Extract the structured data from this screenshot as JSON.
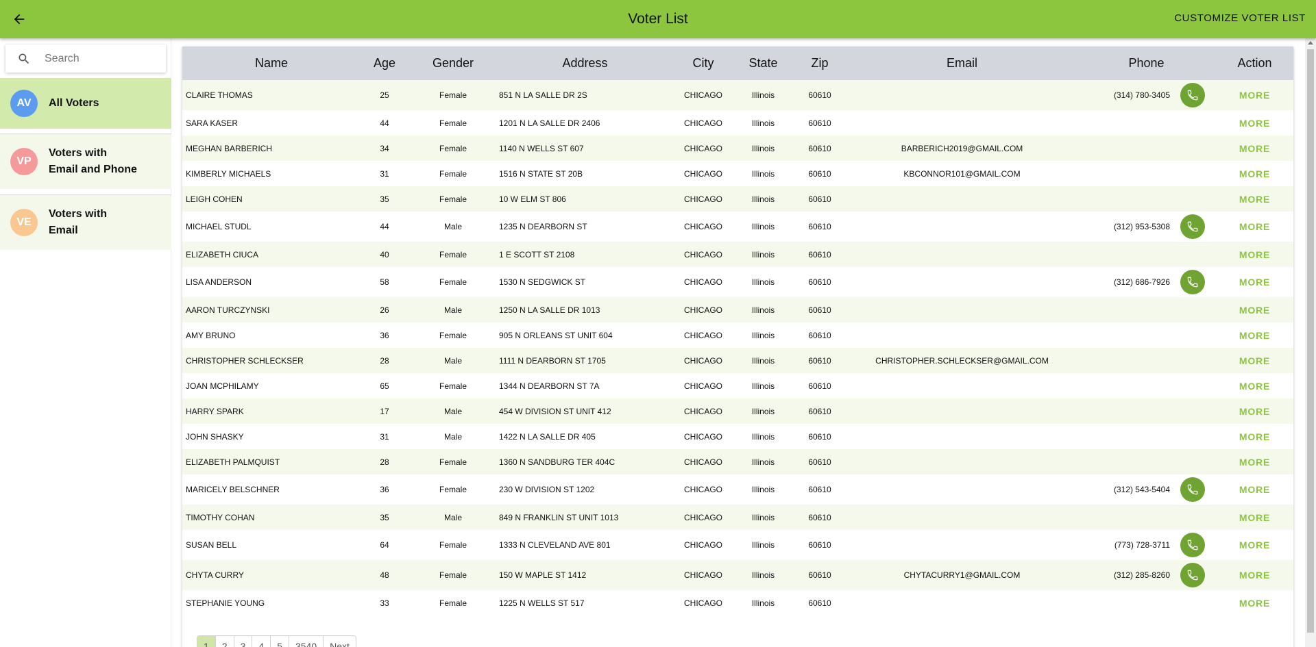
{
  "header": {
    "title": "Voter List",
    "customize_label": "CUSTOMIZE VOTER LIST",
    "bar_color": "#8cc63f"
  },
  "sidebar": {
    "search_placeholder": "Search",
    "items": [
      {
        "initials": "AV",
        "label_line1": "All Voters",
        "label_line2": "",
        "avatar_color": "#5b9cf0",
        "active": true
      },
      {
        "initials": "VP",
        "label_line1": "Voters with",
        "label_line2": "Email and Phone",
        "avatar_color": "#f59a9a",
        "active": false
      },
      {
        "initials": "VE",
        "label_line1": "Voters with",
        "label_line2": "Email",
        "avatar_color": "#fbc790",
        "active": false
      }
    ]
  },
  "table": {
    "columns": [
      "Name",
      "Age",
      "Gender",
      "Address",
      "City",
      "State",
      "Zip",
      "Email",
      "Phone",
      "Action"
    ],
    "action_label": "MORE",
    "rows": [
      {
        "name": "CLAIRE THOMAS",
        "age": "25",
        "gender": "Female",
        "address": "851 N LA SALLE DR 2S",
        "city": "CHICAGO",
        "state": "Illinois",
        "zip": "60610",
        "email": "",
        "phone": "(314) 780-3405"
      },
      {
        "name": "SARA KASER",
        "age": "44",
        "gender": "Female",
        "address": "1201 N LA SALLE DR 2406",
        "city": "CHICAGO",
        "state": "Illinois",
        "zip": "60610",
        "email": "",
        "phone": ""
      },
      {
        "name": "MEGHAN BARBERICH",
        "age": "34",
        "gender": "Female",
        "address": "1140 N WELLS ST 607",
        "city": "CHICAGO",
        "state": "Illinois",
        "zip": "60610",
        "email": "BARBERICH2019@GMAIL.COM",
        "phone": ""
      },
      {
        "name": "KIMBERLY MICHAELS",
        "age": "31",
        "gender": "Female",
        "address": "1516 N STATE ST 20B",
        "city": "CHICAGO",
        "state": "Illinois",
        "zip": "60610",
        "email": "KBCONNOR101@GMAIL.COM",
        "phone": ""
      },
      {
        "name": "LEIGH COHEN",
        "age": "35",
        "gender": "Female",
        "address": "10 W ELM ST 806",
        "city": "CHICAGO",
        "state": "Illinois",
        "zip": "60610",
        "email": "",
        "phone": ""
      },
      {
        "name": "MICHAEL STUDL",
        "age": "44",
        "gender": "Male",
        "address": "1235 N DEARBORN ST",
        "city": "CHICAGO",
        "state": "Illinois",
        "zip": "60610",
        "email": "",
        "phone": "(312) 953-5308"
      },
      {
        "name": "ELIZABETH CIUCA",
        "age": "40",
        "gender": "Female",
        "address": "1 E SCOTT ST 2108",
        "city": "CHICAGO",
        "state": "Illinois",
        "zip": "60610",
        "email": "",
        "phone": ""
      },
      {
        "name": "LISA ANDERSON",
        "age": "58",
        "gender": "Female",
        "address": "1530 N SEDGWICK ST",
        "city": "CHICAGO",
        "state": "Illinois",
        "zip": "60610",
        "email": "",
        "phone": "(312) 686-7926"
      },
      {
        "name": "AARON TURCZYNSKI",
        "age": "26",
        "gender": "Male",
        "address": "1250 N LA SALLE DR 1013",
        "city": "CHICAGO",
        "state": "Illinois",
        "zip": "60610",
        "email": "",
        "phone": ""
      },
      {
        "name": "AMY BRUNO",
        "age": "36",
        "gender": "Female",
        "address": "905 N ORLEANS ST UNIT 604",
        "city": "CHICAGO",
        "state": "Illinois",
        "zip": "60610",
        "email": "",
        "phone": ""
      },
      {
        "name": "CHRISTOPHER SCHLECKSER",
        "age": "28",
        "gender": "Male",
        "address": "1111 N DEARBORN ST 1705",
        "city": "CHICAGO",
        "state": "Illinois",
        "zip": "60610",
        "email": "CHRISTOPHER.SCHLECKSER@GMAIL.COM",
        "phone": ""
      },
      {
        "name": "JOAN MCPHILAMY",
        "age": "65",
        "gender": "Female",
        "address": "1344 N DEARBORN ST 7A",
        "city": "CHICAGO",
        "state": "Illinois",
        "zip": "60610",
        "email": "",
        "phone": ""
      },
      {
        "name": "HARRY SPARK",
        "age": "17",
        "gender": "Male",
        "address": "454 W DIVISION ST UNIT 412",
        "city": "CHICAGO",
        "state": "Illinois",
        "zip": "60610",
        "email": "",
        "phone": ""
      },
      {
        "name": "JOHN SHASKY",
        "age": "31",
        "gender": "Male",
        "address": "1422 N LA SALLE DR 405",
        "city": "CHICAGO",
        "state": "Illinois",
        "zip": "60610",
        "email": "",
        "phone": ""
      },
      {
        "name": "ELIZABETH PALMQUIST",
        "age": "28",
        "gender": "Female",
        "address": "1360 N SANDBURG TER 404C",
        "city": "CHICAGO",
        "state": "Illinois",
        "zip": "60610",
        "email": "",
        "phone": ""
      },
      {
        "name": "MARICELY BELSCHNER",
        "age": "36",
        "gender": "Female",
        "address": "230 W DIVISION ST 1202",
        "city": "CHICAGO",
        "state": "Illinois",
        "zip": "60610",
        "email": "",
        "phone": "(312) 543-5404"
      },
      {
        "name": "TIMOTHY COHAN",
        "age": "35",
        "gender": "Male",
        "address": "849 N FRANKLIN ST UNIT 1013",
        "city": "CHICAGO",
        "state": "Illinois",
        "zip": "60610",
        "email": "",
        "phone": ""
      },
      {
        "name": "SUSAN BELL",
        "age": "64",
        "gender": "Female",
        "address": "1333 N CLEVELAND AVE 801",
        "city": "CHICAGO",
        "state": "Illinois",
        "zip": "60610",
        "email": "",
        "phone": "(773) 728-3711"
      },
      {
        "name": "CHYTA CURRY",
        "age": "48",
        "gender": "Female",
        "address": "150 W MAPLE ST 1412",
        "city": "CHICAGO",
        "state": "Illinois",
        "zip": "60610",
        "email": "CHYTACURRY1@GMAIL.COM",
        "phone": "(312) 285-8260"
      },
      {
        "name": "STEPHANIE YOUNG",
        "age": "33",
        "gender": "Female",
        "address": "1225 N WELLS ST 517",
        "city": "CHICAGO",
        "state": "Illinois",
        "zip": "60610",
        "email": "",
        "phone": ""
      }
    ]
  },
  "pagination": {
    "pages": [
      "1",
      "2",
      "3",
      "4",
      "5",
      "3540"
    ],
    "next_label": "Next",
    "active_page": "1"
  },
  "icons": {
    "back": "arrow-left-icon",
    "search": "search-icon",
    "call": "phone-icon"
  }
}
